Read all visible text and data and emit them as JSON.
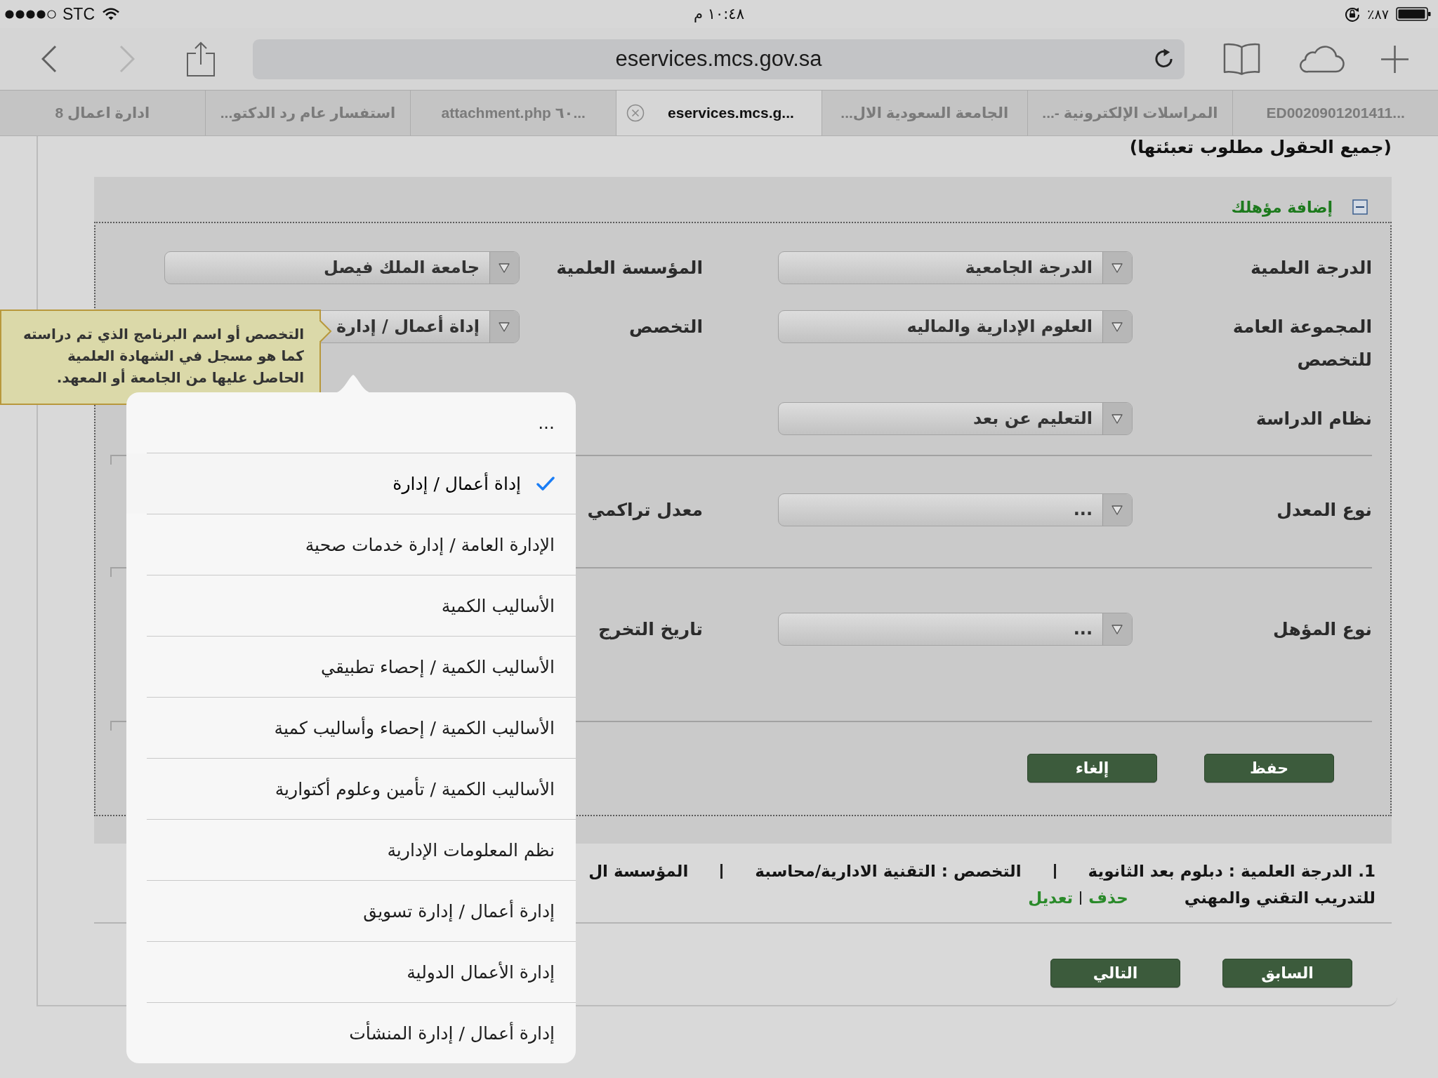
{
  "status_bar": {
    "carrier": "STC",
    "time": "١٠:٤٨ م",
    "battery": "٨٧٪"
  },
  "toolbar": {
    "left_buttons": [
      {
        "kind": "back",
        "disabled": false
      },
      {
        "kind": "forward",
        "disabled": true
      },
      {
        "kind": "share",
        "disabled": false
      }
    ],
    "address": "eservices.mcs.gov.sa",
    "right_buttons": [
      {
        "kind": "bookmarks"
      },
      {
        "kind": "cloud"
      },
      {
        "kind": "new_tab"
      }
    ]
  },
  "tabs": [
    {
      "label": "ED0020901201411...",
      "selected": false
    },
    {
      "label": "المراسلات الإلكترونية -...",
      "selected": false
    },
    {
      "label": "الجامعة السعودية الال...",
      "selected": false
    },
    {
      "label": "eservices.mcs.g...",
      "selected": true
    },
    {
      "label": "attachment.php ٦٠...",
      "selected": false
    },
    {
      "label": "استفسار عام رد الدكتو...",
      "selected": false
    },
    {
      "label": "ادارة اعمال 8",
      "selected": false
    }
  ],
  "page": {
    "note": "(جميع الحقول مطلوب تعبئتها)",
    "panel": {
      "title": "إضافة مؤهلك",
      "expanded": true,
      "groups": [
        {
          "rows": [
            {
              "fields": [
                {
                  "label": "الدرجة العلمية",
                  "kind": "select",
                  "value": "الدرجة الجامعية"
                },
                {
                  "label": "المؤسسة العلمية",
                  "kind": "select",
                  "value": "جامعة الملك فيصل"
                }
              ]
            },
            {
              "fields": [
                {
                  "label": "المجموعة العامة للتخصص",
                  "kind": "select",
                  "value": "العلوم الإدارية والماليه"
                },
                {
                  "label": "التخصص",
                  "kind": "select",
                  "value": "إداة أعمال / إدارة"
                }
              ]
            },
            {
              "fields": [
                {
                  "label": "نظام الدراسة",
                  "kind": "select",
                  "value": "التعليم عن بعد"
                }
              ]
            }
          ]
        },
        {
          "rows": [
            {
              "fields": [
                {
                  "label": "نوع المعدل",
                  "kind": "select",
                  "value": "..."
                },
                {
                  "label": "معدل تراكمي"
                }
              ]
            }
          ]
        },
        {
          "rows": [
            {
              "fields": [
                {
                  "label": "نوع المؤهل",
                  "kind": "select",
                  "value": "..."
                },
                {
                  "label": "تاريخ التخرج"
                }
              ]
            }
          ]
        }
      ],
      "buttons": [
        "حفظ",
        "إلغاء"
      ]
    },
    "records": [
      {
        "parts": [
          "1. الدرجة العلمية : دبلوم بعد الثانوية",
          "التخصص : التقنية الادارية/محاسبة",
          "المؤسسة ال"
        ],
        "continuation": "للتدريب التقني والمهني",
        "actions": [
          "حذف",
          "تعديل"
        ]
      }
    ],
    "nav_buttons": [
      "السابق",
      "التالي"
    ]
  },
  "tooltip": {
    "text": "التخصص أو اسم البرنامج الذي تم دراسته\nكما هو مسجل في الشهادة العلمية\nالحاصل عليها من الجامعة أو المعهد."
  },
  "picker": {
    "items": [
      {
        "label": "...",
        "selected": false
      },
      {
        "label": "إداة أعمال / إدارة",
        "selected": true
      },
      {
        "label": "الإدارة العامة / إدارة خدمات صحية",
        "selected": false
      },
      {
        "label": "الأساليب الكمية",
        "selected": false
      },
      {
        "label": "الأساليب الكمية / إحصاء تطبيقي",
        "selected": false
      },
      {
        "label": "الأساليب الكمية / إحصاء وأساليب كمية",
        "selected": false
      },
      {
        "label": "الأساليب الكمية / تأمين وعلوم أكتوارية",
        "selected": false
      },
      {
        "label": "نظم المعلومات الإدارية",
        "selected": false
      },
      {
        "label": "إدارة أعمال / إدارة تسويق",
        "selected": false
      },
      {
        "label": "إدارة الأعمال الدولية",
        "selected": false
      },
      {
        "label": "إدارة أعمال / إدارة المنشأت",
        "selected": false
      }
    ]
  }
}
